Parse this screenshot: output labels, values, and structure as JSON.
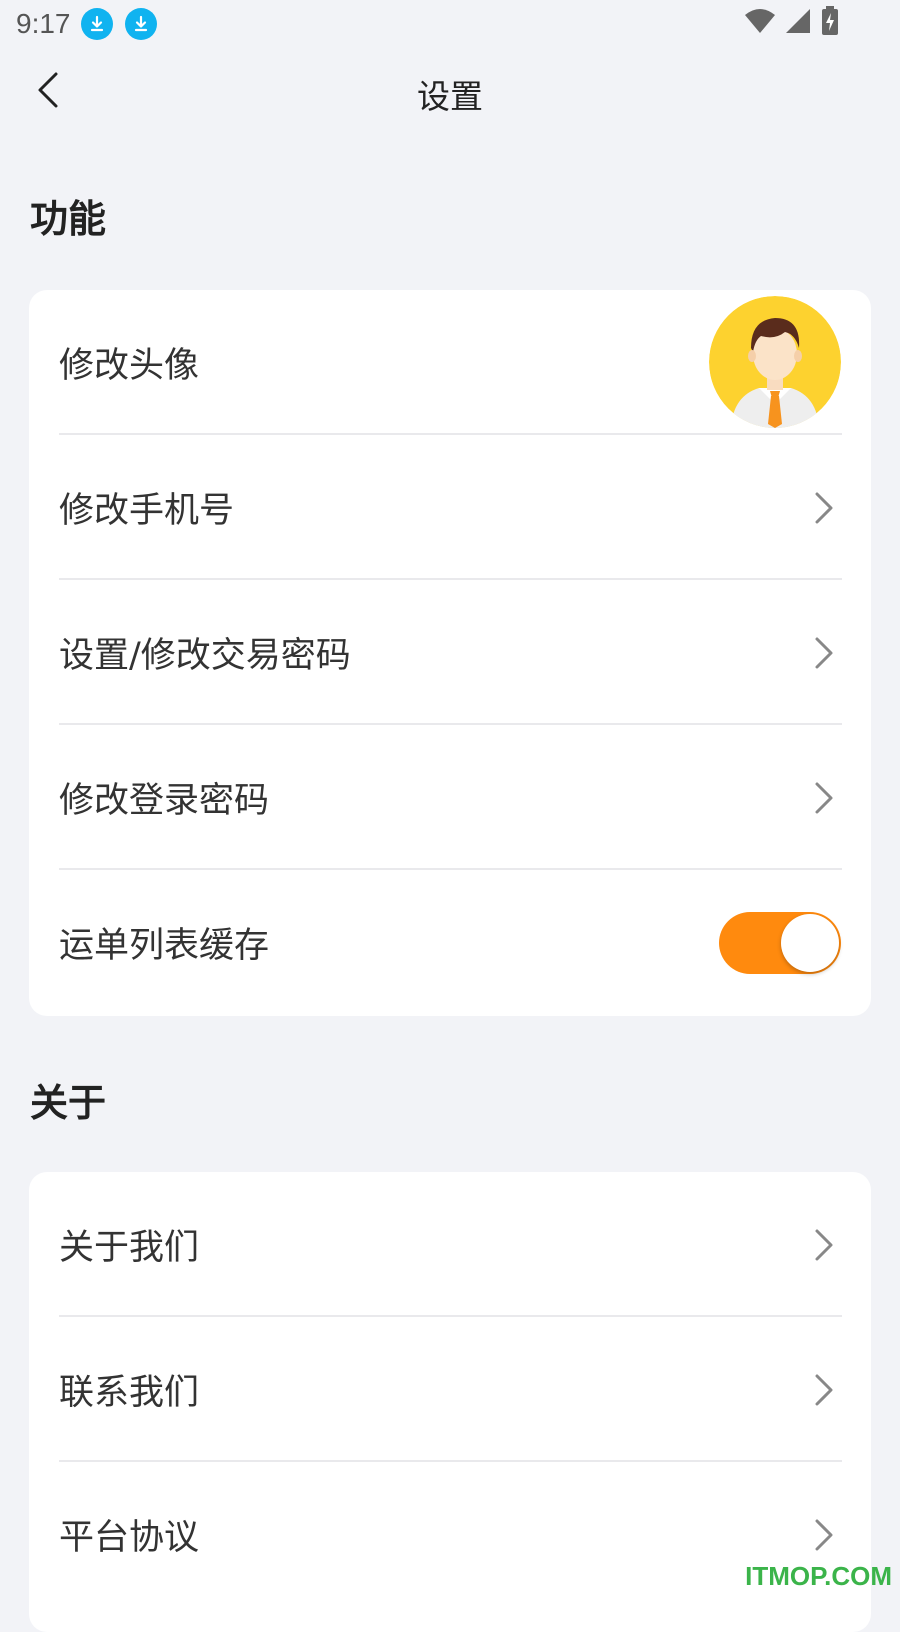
{
  "status_bar": {
    "time": "9:17",
    "icons": [
      "download-icon",
      "download-icon",
      "wifi-icon",
      "signal-icon",
      "battery-charging-icon"
    ]
  },
  "header": {
    "back_icon": "chevron-left-icon",
    "title": "设置"
  },
  "sections": {
    "features": {
      "title": "功能",
      "items": [
        {
          "label": "修改头像"
        },
        {
          "label": "修改手机号"
        },
        {
          "label": "设置/修改交易密码"
        },
        {
          "label": "修改登录密码"
        },
        {
          "label": "运单列表缓存",
          "toggle_on": true
        }
      ]
    },
    "about": {
      "title": "关于",
      "items": [
        {
          "label": "关于我们"
        },
        {
          "label": "联系我们"
        },
        {
          "label": "平台协议"
        }
      ]
    }
  },
  "colors": {
    "accent": "#ff8a0e",
    "background": "#f2f3f7",
    "download_badge": "#10b3f0",
    "avatar_bg": "#fdd22f"
  },
  "watermark": "ITMOP.COM"
}
